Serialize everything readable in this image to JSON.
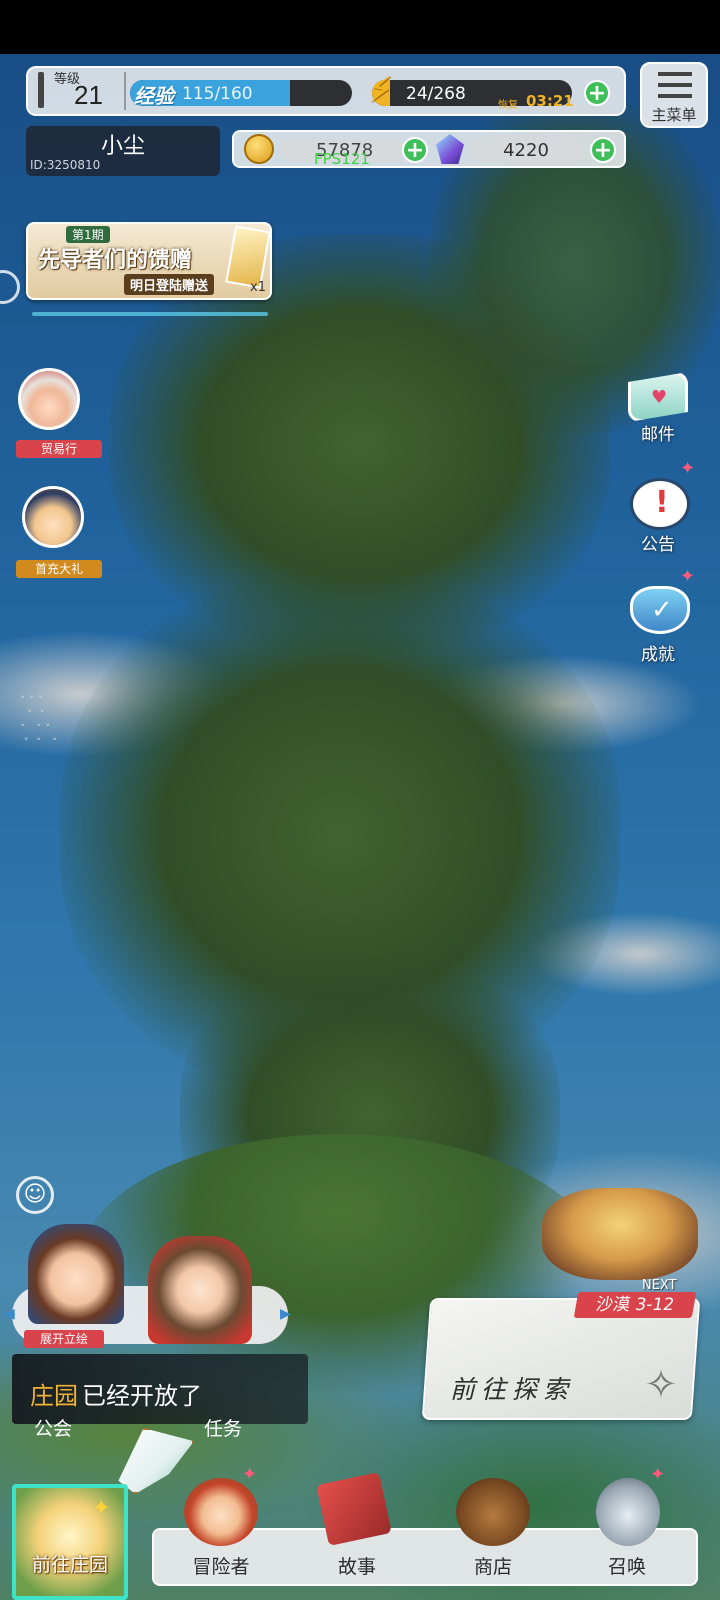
{
  "player": {
    "level_label": "等级",
    "level": "21",
    "name": "小尘",
    "id": "ID:3250810"
  },
  "exp": {
    "label": "经验",
    "value": "115/160",
    "progress": 0.72
  },
  "energy": {
    "value": "24/268",
    "timer_label": "恢复",
    "timer": "03:21",
    "progress": 0.09
  },
  "currency": {
    "gold": "57878",
    "gems": "4220",
    "fps": "FPS121"
  },
  "main_menu": {
    "label": "主菜单"
  },
  "banner": {
    "tag": "第1期",
    "title": "先导者们的馈赠",
    "subtitle": "明日登陆赠送",
    "count": "x1"
  },
  "left_side": {
    "trade": "贸易行",
    "first_recharge": "首充大礼"
  },
  "right_side": {
    "mail": "邮件",
    "notice": "公告",
    "achievement": "成就"
  },
  "team": {
    "expand_label": "展开立绘"
  },
  "explore": {
    "next_label": "NEXT",
    "stage": "沙漠 3-12",
    "button": "前往探索"
  },
  "toast": {
    "highlight": "庄园",
    "text": "已经开放了"
  },
  "under_toast": {
    "guild": "公会",
    "task": "任务"
  },
  "bottom_nav": {
    "manor": "前往庄园",
    "adventurer": "冒险者",
    "story": "故事",
    "shop": "商店",
    "summon": "召唤"
  },
  "colors": {
    "exp_bar": "#3aa2dd",
    "energy_bar": "#f0b226",
    "accent_gold": "#f2b233",
    "tag_red": "#d9434b"
  }
}
